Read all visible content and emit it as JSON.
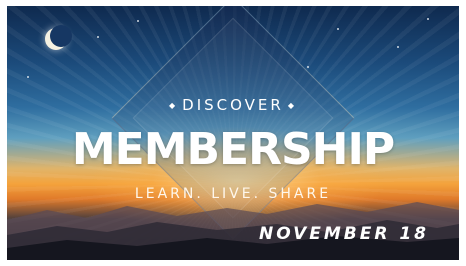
{
  "banner": {
    "kicker": "DISCOVER",
    "kicker_ornament": "◆",
    "title": "MEMBERSHIP",
    "tagline": "LEARN. LIVE. SHARE",
    "date": "NOVEMBER 18"
  },
  "colors": {
    "sky_top": "#0f2a4f",
    "sunset": "#f4a33c",
    "text": "#ffffff"
  }
}
